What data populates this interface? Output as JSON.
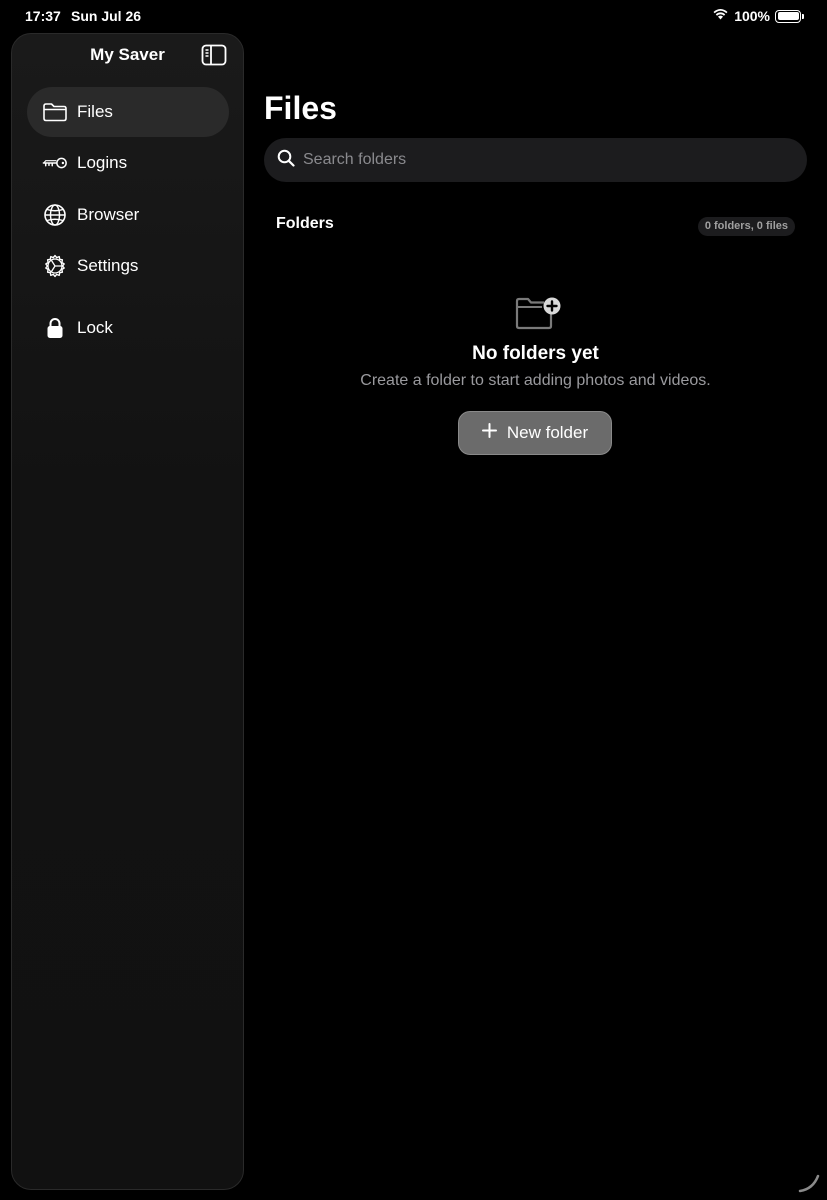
{
  "status_bar": {
    "time": "17:37",
    "date": "Sun Jul 26",
    "battery": "100%"
  },
  "sidebar": {
    "title": "My Saver",
    "items": [
      {
        "label": "Files",
        "icon": "folder-icon",
        "active": true
      },
      {
        "label": "Logins",
        "icon": "key-icon",
        "active": false
      },
      {
        "label": "Browser",
        "icon": "globe-icon",
        "active": false
      },
      {
        "label": "Settings",
        "icon": "gear-icon",
        "active": false
      },
      {
        "label": "Lock",
        "icon": "lock-icon",
        "active": false
      }
    ]
  },
  "main": {
    "title": "Files",
    "search": {
      "placeholder": "Search folders",
      "value": ""
    },
    "section_title": "Folders",
    "count_badge": "0 folders, 0 files",
    "empty_state": {
      "icon": "folder-plus-icon",
      "title": "No folders yet",
      "subtitle": "Create a folder to start adding photos and videos.",
      "button_label": "New folder"
    }
  },
  "colors": {
    "background": "#000000",
    "sidebar": "#121212",
    "active_item": "#2a2a2a",
    "button": "#6b6b6b",
    "secondary_text": "#9a9a9e"
  }
}
